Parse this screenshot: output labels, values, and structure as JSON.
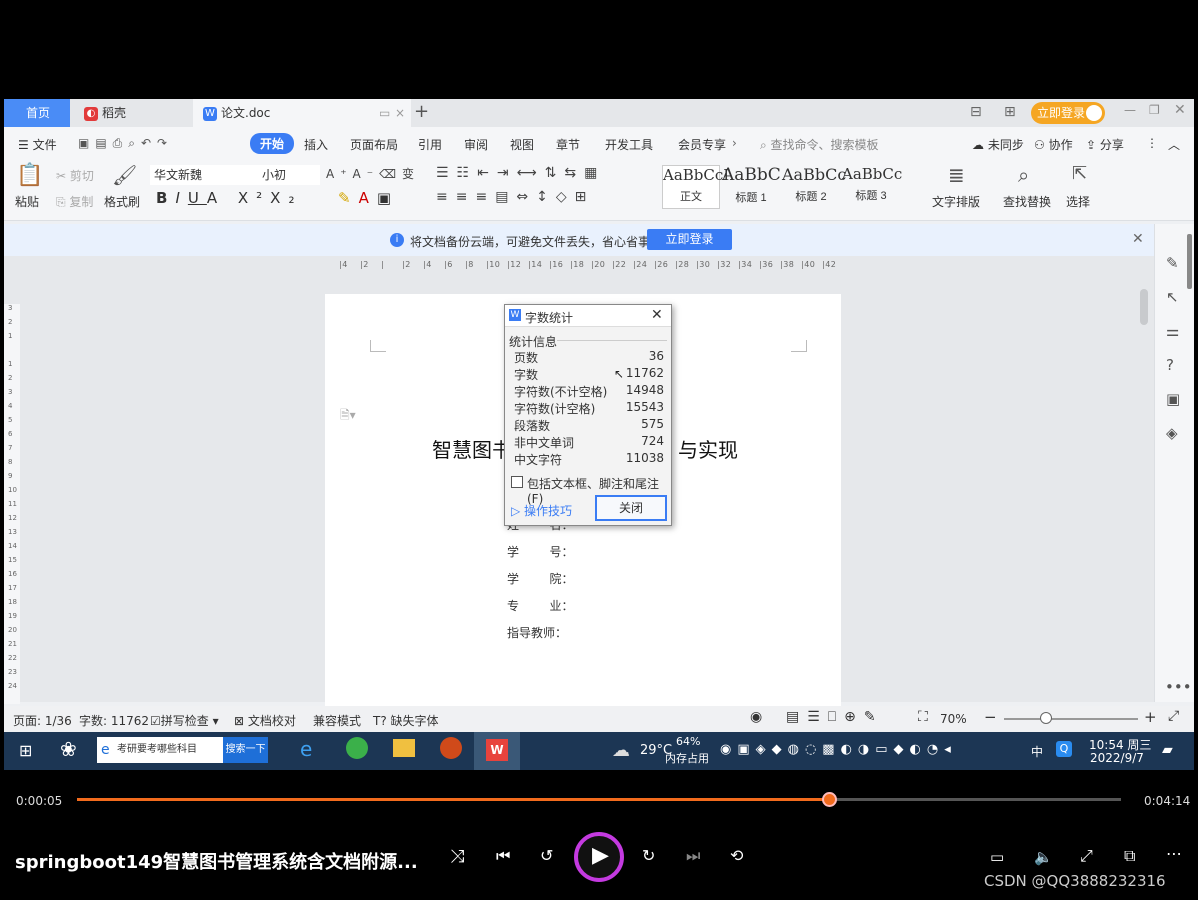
{
  "tabs": {
    "home": "首页",
    "daoke": "稻壳",
    "doc": "论文.doc",
    "new_tab": "+"
  },
  "window": {
    "login": "立即登录"
  },
  "menu": {
    "file": "文件",
    "items": [
      "开始",
      "插入",
      "页面布局",
      "引用",
      "审阅",
      "视图",
      "章节",
      "开发工具",
      "会员专享"
    ],
    "search_placeholder": "查找命令、搜索模板",
    "unsync": "未同步",
    "collab": "协作",
    "share": "分享"
  },
  "ribbon": {
    "paste": "粘贴",
    "cut": "剪切",
    "copy": "复制",
    "format_painter": "格式刷",
    "font": "华文新魏",
    "size": "小初",
    "styles": [
      {
        "sample": "AaBbCcI",
        "name": "正文"
      },
      {
        "sample": "AaBbC",
        "name": "标题 1"
      },
      {
        "sample": "AaBbCc",
        "name": "标题 2"
      },
      {
        "sample": "AaBbCc",
        "name": "标题 3"
      }
    ],
    "text_layout": "文字排版",
    "find_replace": "查找替换",
    "select": "选择"
  },
  "notice": {
    "text": "将文档备份云端，可避免文件丢失，省心省事",
    "button": "立即登录"
  },
  "ruler": {
    "ticks": [
      "4",
      "2",
      "",
      "2",
      "4",
      "6",
      "8",
      "10",
      "12",
      "14",
      "16",
      "18",
      "20",
      "22",
      "24",
      "26",
      "28",
      "30",
      "32",
      "34",
      "36",
      "38",
      "40",
      "42"
    ],
    "vticks": [
      "3",
      "2",
      "1",
      "",
      "1",
      "2",
      "3",
      "4",
      "5",
      "6",
      "7",
      "8",
      "9",
      "10",
      "11",
      "12",
      "13",
      "14",
      "15",
      "16",
      "17",
      "18",
      "19",
      "20",
      "21",
      "22",
      "23",
      "24"
    ]
  },
  "document": {
    "title_left": "智慧图书",
    "title_right": "与实现",
    "fields": [
      {
        "label": "姓        名：",
        "name": "name-field"
      },
      {
        "label": "学        号：",
        "name": "id-field"
      },
      {
        "label": "学        院：",
        "name": "college-field"
      },
      {
        "label": "专        业：",
        "name": "major-field"
      },
      {
        "label": "指导教师：",
        "name": "advisor-field"
      }
    ]
  },
  "dialog": {
    "title": "字数统计",
    "section": "统计信息",
    "stats": [
      {
        "label": "页数",
        "value": "36"
      },
      {
        "label": "字数",
        "value": "11762"
      },
      {
        "label": "字符数(不计空格)",
        "value": "14948"
      },
      {
        "label": "字符数(计空格)",
        "value": "15543"
      },
      {
        "label": "段落数",
        "value": "575"
      },
      {
        "label": "非中文单词",
        "value": "724"
      },
      {
        "label": "中文字符",
        "value": "11038"
      }
    ],
    "include_checkbox": "包括文本框、脚注和尾注(F)",
    "tips": "操作技巧",
    "close": "关闭"
  },
  "statusbar": {
    "page": "页面: 1/36",
    "words": "字数: 11762",
    "spell": "拼写检查",
    "proof": "文档校对",
    "compat": "兼容模式",
    "missing_font": "缺失字体",
    "zoom": "70%"
  },
  "taskbar": {
    "search_text": "考研要考哪些科目",
    "search_btn": "搜索一下",
    "weather": "29°C",
    "memory_pct": "64%",
    "memory_label": "内存占用",
    "ime": "中",
    "time": "10:54 周三",
    "date": "2022/9/7"
  },
  "player": {
    "elapsed": "0:00:05",
    "total": "0:04:14",
    "progress": 0.72,
    "title": "springboot149智慧图书管理系统含文档附源...",
    "watermark": "CSDN @QQ3888232316"
  },
  "colors": {
    "accent": "#3a7cf4",
    "progress": "#f26b1d",
    "taskbar": "#1c3654"
  }
}
